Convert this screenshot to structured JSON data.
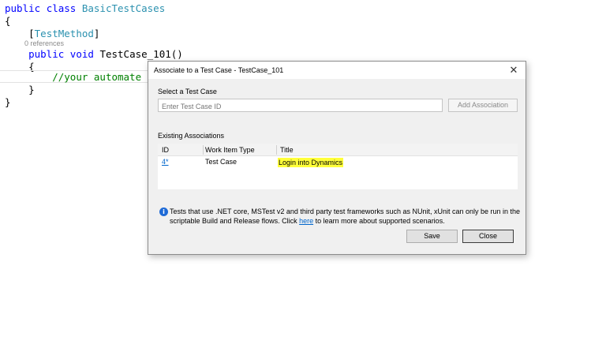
{
  "editor": {
    "kw_public": "public",
    "kw_class": "class",
    "class_name": "BasicTestCases",
    "open_brace": "{",
    "attr_open": "[",
    "attr_name": "TestMethod",
    "attr_close": "]",
    "codelens": "0 references",
    "kw_void": "void",
    "method_name": "TestCase_101()",
    "method_open": "{",
    "comment": "//your automate test",
    "method_close": "}",
    "close_brace": "}"
  },
  "dialog": {
    "title": "Associate to a Test Case - TestCase_101",
    "close_glyph": "✕",
    "select_label": "Select a Test Case",
    "input_placeholder": "Enter Test Case ID",
    "add_button": "Add Association",
    "existing_label": "Existing Associations",
    "columns": [
      "ID",
      "Work Item Type",
      "Title"
    ],
    "rows": [
      {
        "id": "4*",
        "type": "Test Case",
        "title": "Login into Dynamics"
      }
    ],
    "info_icon": "i",
    "note_before": "Tests that use .NET core, MSTest v2 and third party test frameworks such as NUnit, xUnit can only be run in the scriptable Build and Release flows. Click ",
    "note_link": "here",
    "note_after": " to learn more about supported scenarios.",
    "save_button": "Save",
    "close_button": "Close"
  },
  "colors": {
    "keyword": "#0000ff",
    "type": "#2b91af",
    "comment": "#008000",
    "highlight": "#ffff3a",
    "link": "#0066cc"
  }
}
